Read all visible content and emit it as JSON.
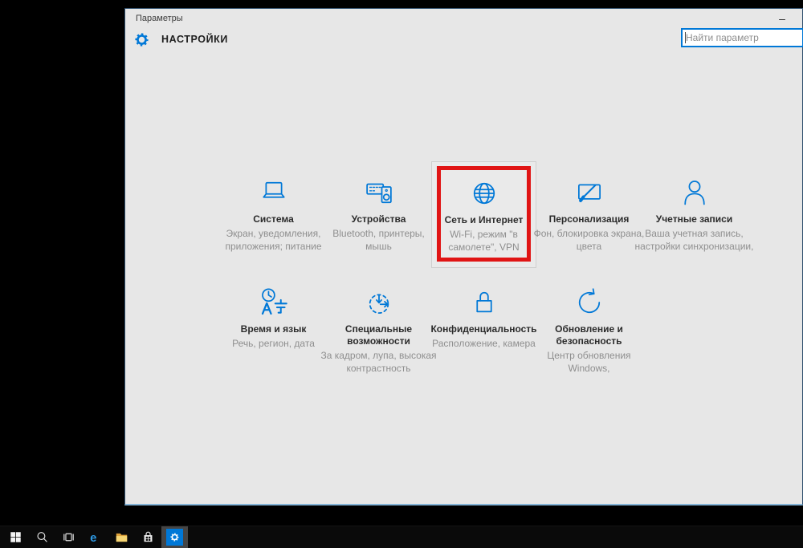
{
  "window": {
    "title": "Параметры",
    "minimize_label": "–",
    "header_title": "НАСТРОЙКИ",
    "search": {
      "placeholder": "Найти параметр"
    }
  },
  "tiles": [
    {
      "name": "system",
      "icon": "laptop",
      "title": "Система",
      "subtitle": "Экран, уведомления, приложения; питание",
      "highlighted": false
    },
    {
      "name": "devices",
      "icon": "devices",
      "title": "Устройства",
      "subtitle": "Bluetooth, принтеры, мышь",
      "highlighted": false
    },
    {
      "name": "network-internet",
      "icon": "globe",
      "title": "Сеть и Интернет",
      "subtitle": "Wi-Fi, режим \"в самолете\", VPN",
      "highlighted": true
    },
    {
      "name": "personalization",
      "icon": "personalization",
      "title": "Персонализация",
      "subtitle": "Фон, блокировка экрана, цвета",
      "highlighted": false
    },
    {
      "name": "accounts",
      "icon": "account",
      "title": "Учетные записи",
      "subtitle": "Ваша учетная запись, настройки синхронизации,",
      "highlighted": false
    },
    {
      "name": "time-language",
      "icon": "time-language",
      "title": "Время и язык",
      "subtitle": "Речь, регион, дата",
      "highlighted": false
    },
    {
      "name": "ease-of-access",
      "icon": "ease",
      "title": "Специальные возможности",
      "subtitle": "За кадром, лупа, высокая контрастность",
      "highlighted": false
    },
    {
      "name": "privacy",
      "icon": "privacy",
      "title": "Конфиденциальность",
      "subtitle": "Расположение, камера",
      "highlighted": false
    },
    {
      "name": "update-security",
      "icon": "update",
      "title": "Обновление и безопасность",
      "subtitle": "Центр обновления Windows,",
      "highlighted": false
    }
  ],
  "taskbar": {
    "items": [
      {
        "name": "start-button",
        "icon": "start",
        "color": "#f5f5f5",
        "active": false,
        "tile": false
      },
      {
        "name": "taskbar-search-button",
        "icon": "tb-search",
        "color": "#e8e8e8",
        "active": false,
        "tile": false
      },
      {
        "name": "task-view-button",
        "icon": "taskview",
        "color": "#e8e8e8",
        "active": false,
        "tile": false
      },
      {
        "name": "edge-button",
        "icon": "edge",
        "color": "#2e9be6",
        "active": false,
        "tile": false
      },
      {
        "name": "file-explorer-button",
        "icon": "folder",
        "color": "#f7d674",
        "active": false,
        "tile": false
      },
      {
        "name": "store-button",
        "icon": "store",
        "color": "#f2f2f2",
        "active": false,
        "tile": false
      },
      {
        "name": "settings-button",
        "icon": "gear",
        "color": "#ffffff",
        "active": true,
        "tile": true
      }
    ]
  },
  "colors": {
    "accent_blue": "#0078d7",
    "annotation_red": "#e01414",
    "window_background": "#e7e7e7",
    "desktop_background": "#000000",
    "taskbar_background": "#0a0a0a"
  }
}
